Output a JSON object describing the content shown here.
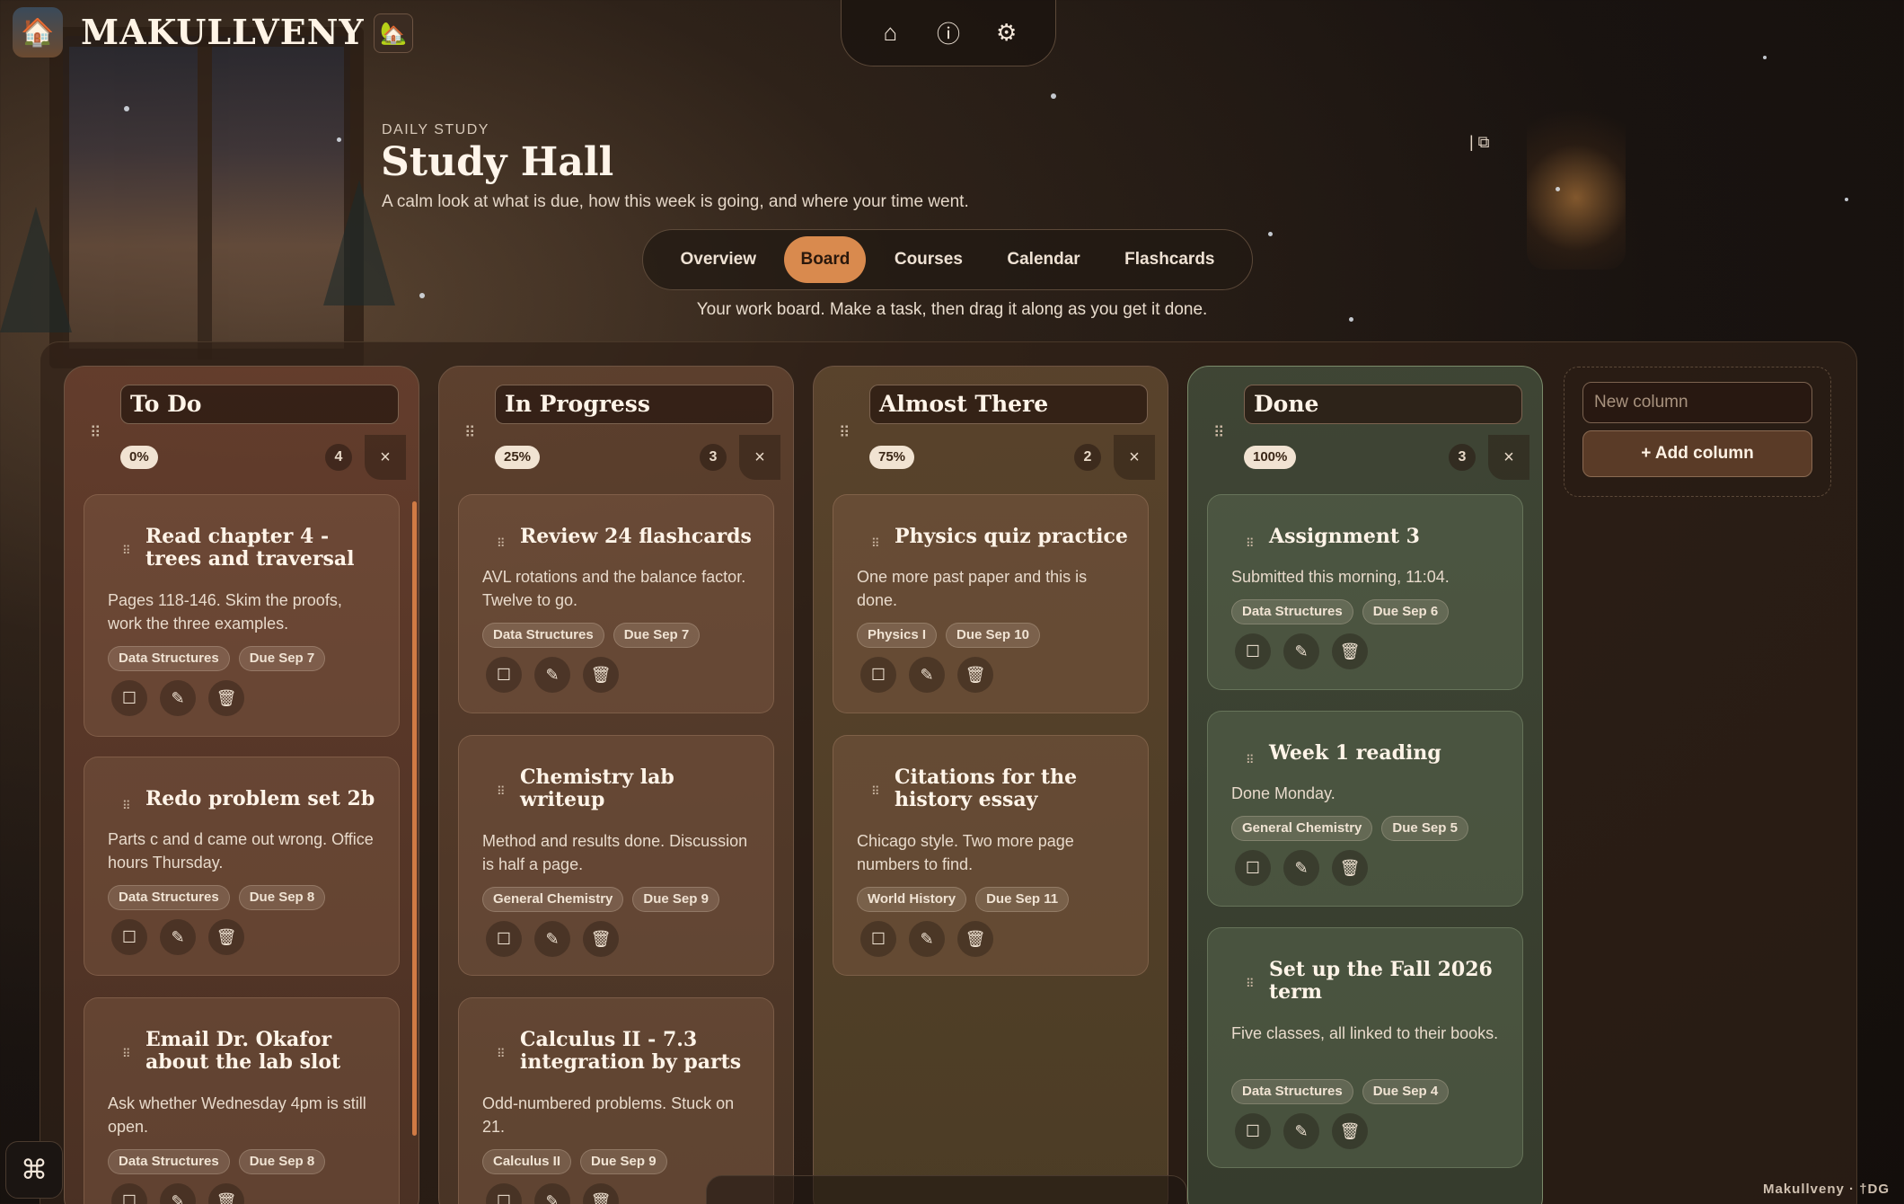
{
  "app": {
    "name": "MAKULLVENY",
    "footer": "Makullveny · †DG"
  },
  "topnav": {
    "home_icon": "⌂",
    "info_icon": "ⓘ",
    "settings_icon": "⚙"
  },
  "header": {
    "eyebrow": "DAILY STUDY",
    "title": "Study Hall",
    "subtitle": "A calm look at what is due, how this week is going, and where your time went.",
    "corner": "| ⧉"
  },
  "tabs": [
    {
      "label": "Overview"
    },
    {
      "label": "Board"
    },
    {
      "label": "Courses"
    },
    {
      "label": "Calendar"
    },
    {
      "label": "Flashcards"
    }
  ],
  "active_tab": "Board",
  "hint": "Your work board. Make a task, then drag it along as you get it done.",
  "columns": [
    {
      "name": "To Do",
      "percent": "0%",
      "count": "4",
      "close": "×",
      "cards": [
        {
          "title": "Read chapter 4 - trees and traversal",
          "desc": "Pages 118-146. Skim the proofs, work the three examples.",
          "course": "Data Structures",
          "due": "Due Sep 7"
        },
        {
          "title": "Redo problem set 2b",
          "desc": "Parts c and d came out wrong. Office hours Thursday.",
          "course": "Data Structures",
          "due": "Due Sep 8"
        },
        {
          "title": "Email Dr. Okafor about the lab slot",
          "desc": "Ask whether Wednesday 4pm is still open.",
          "course": "Data Structures",
          "due": "Due Sep 8"
        }
      ]
    },
    {
      "name": "In Progress",
      "percent": "25%",
      "count": "3",
      "close": "×",
      "cards": [
        {
          "title": "Review 24 flashcards",
          "desc": "AVL rotations and the balance factor. Twelve to go.",
          "course": "Data Structures",
          "due": "Due Sep 7"
        },
        {
          "title": "Chemistry lab writeup",
          "desc": "Method and results done. Discussion is half a page.",
          "course": "General Chemistry",
          "due": "Due Sep 9"
        },
        {
          "title": "Calculus II - 7.3 integration by parts",
          "desc": "Odd-numbered problems. Stuck on 21.",
          "course": "Calculus II",
          "due": "Due Sep 9"
        }
      ]
    },
    {
      "name": "Almost There",
      "percent": "75%",
      "count": "2",
      "close": "×",
      "cards": [
        {
          "title": "Physics quiz practice",
          "desc": "One more past paper and this is done.",
          "course": "Physics I",
          "due": "Due Sep 10"
        },
        {
          "title": "Citations for the history essay",
          "desc": "Chicago style. Two more page numbers to find.",
          "course": "World History",
          "due": "Due Sep 11"
        }
      ]
    },
    {
      "name": "Done",
      "percent": "100%",
      "count": "3",
      "close": "×",
      "cards": [
        {
          "title": "Assignment 3",
          "desc": "Submitted this morning, 11:04.",
          "course": "Data Structures",
          "due": "Due Sep 6"
        },
        {
          "title": "Week 1 reading",
          "desc": "Done Monday.",
          "course": "General Chemistry",
          "due": "Due Sep 5"
        },
        {
          "title": "Set up the Fall 2026 term",
          "desc": "Five classes, all linked to their books.",
          "course": "Data Structures",
          "due": "Due Sep 4"
        }
      ]
    }
  ],
  "new_column": {
    "placeholder": "New column",
    "button": "+ Add column"
  },
  "card_actions": {
    "check_icon": "☐",
    "edit_icon": "✎",
    "delete_icon": "🗑"
  },
  "cmd_icon": "⌘"
}
